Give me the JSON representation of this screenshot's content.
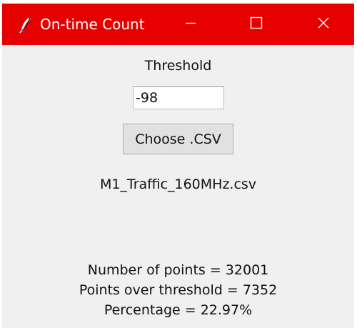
{
  "window": {
    "title": "On-time Count",
    "icon": "feather-icon",
    "controls": {
      "minimize": "minimize-icon",
      "maximize": "maximize-icon",
      "close": "close-icon"
    }
  },
  "form": {
    "threshold_label": "Threshold",
    "threshold_value": "-98",
    "choose_button_label": "Choose .CSV",
    "selected_file": "M1_Traffic_160MHz.csv"
  },
  "results": {
    "num_points": "Number of points = 32001",
    "points_over": "Points over threshold = 7352",
    "percentage": "Percentage = 22.97%"
  },
  "colors": {
    "titlebar": "#e60000",
    "window_bg": "#f0f0f0"
  }
}
